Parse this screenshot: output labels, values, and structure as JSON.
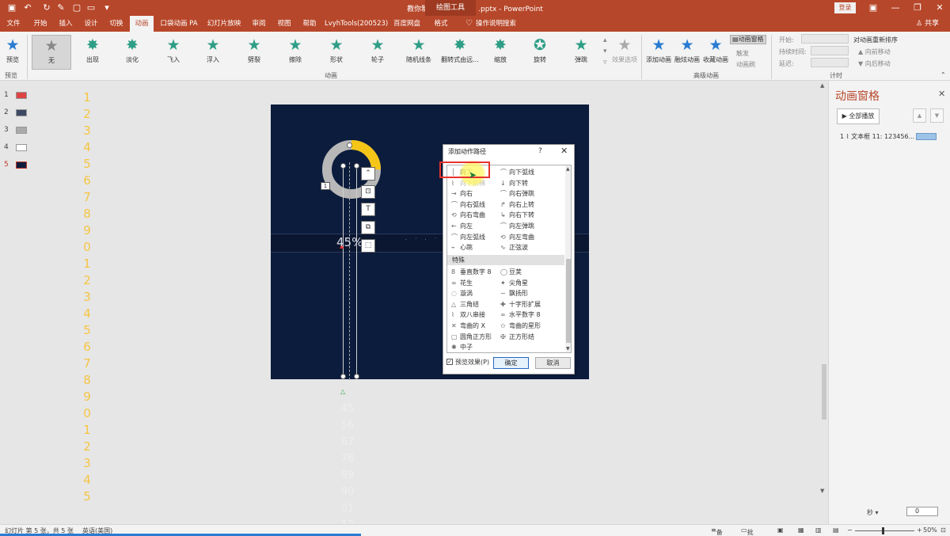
{
  "titlebar": {
    "title": "教你制作《数字滚动》.pptx  -  PowerPoint",
    "context_tool": "绘图工具",
    "login": "登录"
  },
  "tabs": [
    {
      "label": "文件"
    },
    {
      "label": "开始"
    },
    {
      "label": "插入"
    },
    {
      "label": "设计"
    },
    {
      "label": "切换"
    },
    {
      "label": "动画"
    },
    {
      "label": "口袋动画 PA"
    },
    {
      "label": "幻灯片放映"
    },
    {
      "label": "审阅"
    },
    {
      "label": "视图"
    },
    {
      "label": "帮助"
    },
    {
      "label": "LvyhTools(200523)"
    },
    {
      "label": "百度网盘"
    },
    {
      "label": "格式"
    },
    {
      "label": "操作说明搜索"
    }
  ],
  "share": "共享",
  "ribbon": {
    "preview": "预览",
    "preview_group": "预览",
    "animations": [
      {
        "label": "无"
      },
      {
        "label": "出现"
      },
      {
        "label": "淡化"
      },
      {
        "label": "飞入"
      },
      {
        "label": "浮入"
      },
      {
        "label": "劈裂"
      },
      {
        "label": "擦除"
      },
      {
        "label": "形状"
      },
      {
        "label": "轮子"
      },
      {
        "label": "随机线条"
      },
      {
        "label": "翻转式由远..."
      },
      {
        "label": "缩放"
      },
      {
        "label": "旋转"
      },
      {
        "label": "弹跳"
      }
    ],
    "effect_options": "效果选项",
    "animation_group": "动画",
    "add_animation": "添加动画",
    "painter": "融炫动画",
    "collect": "收藏动画",
    "anim_pane": "动画窗格",
    "trigger": "触发",
    "anim_brush": "动画刷",
    "advanced_group": "高级动画",
    "start": "开始:",
    "duration": "持续时间:",
    "delay": "延迟:",
    "reorder": "对动画重新排序",
    "move_earlier": "向前移动",
    "move_later": "向后移动",
    "timing_group": "计时"
  },
  "slides": [
    {
      "num": "1"
    },
    {
      "num": "2"
    },
    {
      "num": "3"
    },
    {
      "num": "4"
    },
    {
      "num": "5"
    }
  ],
  "editor": {
    "digits": [
      "1",
      "2",
      "3",
      "4",
      "5",
      "6",
      "7",
      "8",
      "9",
      "0",
      "1",
      "2",
      "3",
      "4",
      "5",
      "6",
      "7",
      "8",
      "9",
      "0",
      "1",
      "2",
      "3",
      "4",
      "5"
    ],
    "percent": "45%",
    "badge": "1",
    "rolling": [
      "45",
      "56",
      "67",
      "78",
      "89",
      "90",
      "01",
      "12"
    ]
  },
  "dialog": {
    "title": "添加动作路径",
    "help": "?",
    "close": "✕",
    "left_paths": [
      "向下",
      "向下阶梯",
      "向右",
      "向右弧线",
      "向右弯曲",
      "向左",
      "向左弧线",
      "心跳"
    ],
    "right_paths": [
      "向下弧线",
      "向下转",
      "向右弹跳",
      "向右上转",
      "向右下转",
      "向左弹跳",
      "向左弯曲",
      "正弦波"
    ],
    "special_header": "特殊",
    "special_left": [
      "垂直数字 8",
      "花生",
      "漩涡",
      "三角结",
      "双八串接",
      "弯曲的 X",
      "圆角正方形",
      "中子"
    ],
    "special_right": [
      "豆荚",
      "尖角星",
      "飘扬形",
      "十字形扩展",
      "水平数字 8",
      "弯曲的星形",
      "正方形结"
    ],
    "preview_effect": "预览效果(P)",
    "ok": "确定",
    "cancel": "取消"
  },
  "anim_pane": {
    "title": "动画窗格",
    "play_all": "全部播放",
    "item": "1 ⌇ 文本框 11: 123456...",
    "seconds": "秒 ▾",
    "zero": "0"
  },
  "statusbar": {
    "slide_info": "幻灯片 第 5 张，共 5 张",
    "lang": "英语(美国)",
    "notes": "备注",
    "comments": "批注",
    "zoom": "50%"
  },
  "colors": {
    "accent": "#b7472a",
    "slide_bg": "#0c1c3d",
    "digit": "#f5c542",
    "donut_fill": "#f5c518",
    "donut_bg": "#b8b8b8"
  },
  "progress": {
    "donut_fraction": 0.25
  }
}
